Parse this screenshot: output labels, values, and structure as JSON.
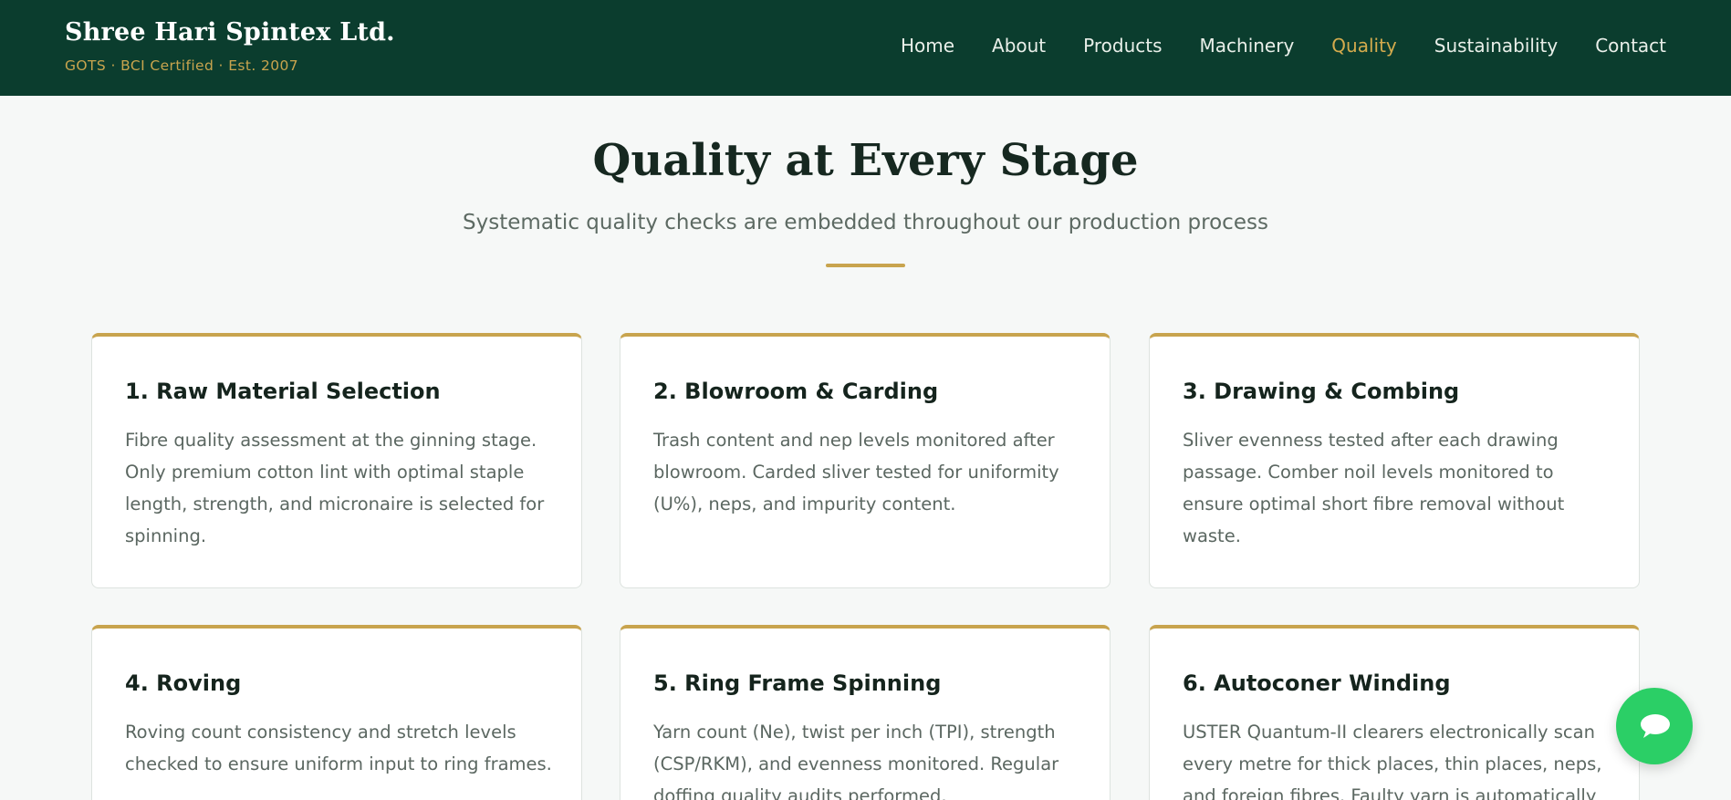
{
  "header": {
    "brand_name": "Shree Hari Spintex Ltd.",
    "brand_tagline": "GOTS · BCI Certified · Est. 2007",
    "nav": [
      {
        "label": "Home"
      },
      {
        "label": "About"
      },
      {
        "label": "Products"
      },
      {
        "label": "Machinery"
      },
      {
        "label": "Quality",
        "active": true
      },
      {
        "label": "Sustainability"
      },
      {
        "label": "Contact"
      }
    ]
  },
  "section": {
    "title": "Quality at Every Stage",
    "subtitle": "Systematic quality checks are embedded throughout our production process"
  },
  "cards": [
    {
      "title": "1. Raw Material Selection",
      "text": "Fibre quality assessment at the ginning stage. Only premium cotton lint with optimal staple length, strength, and micronaire is selected for spinning."
    },
    {
      "title": "2. Blowroom & Carding",
      "text": "Trash content and nep levels monitored after blowroom. Carded sliver tested for uniformity (U%), neps, and impurity content."
    },
    {
      "title": "3. Drawing & Combing",
      "text": "Sliver evenness tested after each drawing passage. Comber noil levels monitored to ensure optimal short fibre removal without waste."
    },
    {
      "title": "4. Roving",
      "text": "Roving count consistency and stretch levels checked to ensure uniform input to ring frames."
    },
    {
      "title": "5. Ring Frame Spinning",
      "text": "Yarn count (Ne), twist per inch (TPI), strength (CSP/RKM), and evenness monitored. Regular doffing quality audits performed."
    },
    {
      "title": "6. Autoconer Winding",
      "text": "USTER Quantum-II clearers electronically scan every metre for thick places, thin places, neps, and foreign fibres. Faulty yarn is automatically"
    }
  ],
  "chat": {
    "icon": "chat-bubble-icon",
    "color": "#2bcf66"
  },
  "colors": {
    "header_bg": "#0b3d2e",
    "accent_gold": "#c8a44e",
    "active_nav": "#d4ab4d"
  }
}
